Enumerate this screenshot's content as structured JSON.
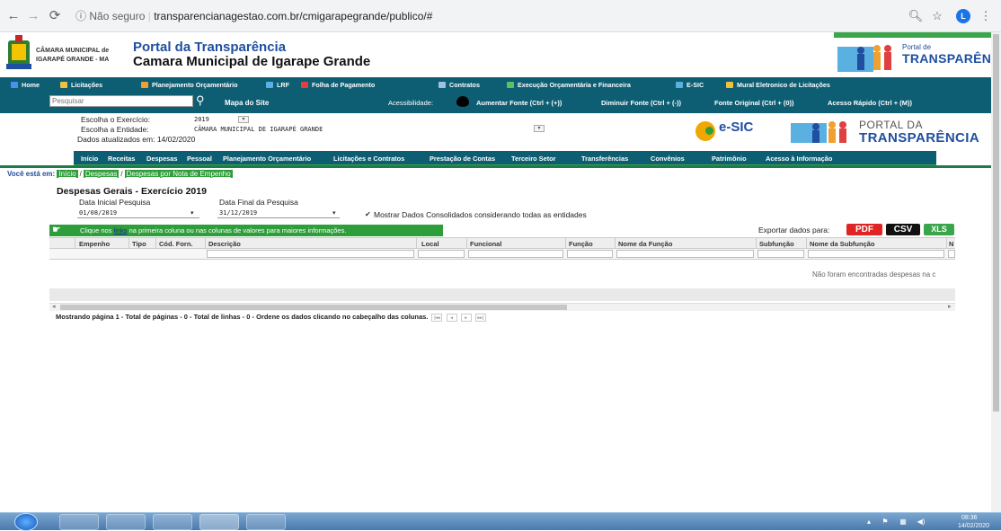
{
  "browser": {
    "security_label": "Não seguro",
    "url": "transparencianagestao.com.br/cmigarapegrande/publico/#",
    "avatar_initial": "L"
  },
  "header": {
    "logo_line1": "CÂMARA MUNICIPAL de",
    "logo_line2": "IGARAPÉ GRANDE - MA",
    "title": "Portal da Transparência",
    "subtitle": "Camara Municipal de Igarape Grande",
    "banner_word1": "Portal de",
    "banner_word2": "TRANSPARÊNCIA"
  },
  "topnav": [
    {
      "label": "Home",
      "icon": "home-icon",
      "color": "#4b8ff0"
    },
    {
      "label": "Licitações",
      "icon": "folder-icon",
      "color": "#f0c040"
    },
    {
      "label": "Planejamento Orçamentário",
      "icon": "pyramid-icon",
      "color": "#f0a030"
    },
    {
      "label": "LRF",
      "icon": "chart-icon",
      "color": "#5ab0e0"
    },
    {
      "label": "Folha de Pagamento",
      "icon": "payroll-icon",
      "color": "#e04040"
    },
    {
      "label": "Contratos",
      "icon": "document-icon",
      "color": "#a0c0e0"
    },
    {
      "label": "Execução Orçamentária e Financeira",
      "icon": "growth-icon",
      "color": "#60c060"
    },
    {
      "label": "E-SIC",
      "icon": "info-icon",
      "color": "#5ab0e0"
    },
    {
      "label": "Mural Eletronico de Licitações",
      "icon": "board-icon",
      "color": "#f0c040"
    }
  ],
  "accessibility": {
    "search_placeholder": "Pesquisar",
    "site_map": "Mapa do Site",
    "label": "Acessibilidade:",
    "increase": "Aumentar Fonte (Ctrl + (+))",
    "decrease": "Diminuir Fonte (Ctrl + (-))",
    "original": "Fonte Original (Ctrl + (0))",
    "quick": "Acesso Rápido (Ctrl + (M))"
  },
  "filter": {
    "exercise_label": "Escolha o Exercício:",
    "exercise_value": "2019",
    "entity_label": "Escolha a Entidade:",
    "entity_value": "CÂMARA MUNICIPAL DE IGARAPÉ GRANDE",
    "updated": "Dados atualizados em: 14/02/2020",
    "esic_logo": "e-SIC",
    "portal_logo_word1": "PORTAL DA",
    "portal_logo_word2": "TRANSPARÊNCIA"
  },
  "mainmenu": [
    "Início",
    "Receitas",
    "Despesas",
    "Pessoal",
    "Planejamento Orçamentário",
    "Licitações e Contratos",
    "Prestação de Contas",
    "Terceiro Setor",
    "Transferências",
    "Convênios",
    "Patrimônio",
    "Acesso à Informação"
  ],
  "breadcrumb": {
    "label": "Você está em:",
    "items": [
      "Início",
      "Despesas",
      "Despesas por Nota de Empenho"
    ]
  },
  "section": {
    "title": "Despesas Gerais - Exercício 2019",
    "start_label": "Data Inicial Pesquisa",
    "start_value": "01/08/2019",
    "end_label": "Data Final da Pesquisa",
    "end_value": "31/12/2019",
    "consolidated_label": "Mostrar Dados Consolidados considerando todas as entidades"
  },
  "infobar": {
    "prefix": "Clique nos ",
    "link": "links",
    "suffix": " na primeira coluna ou nas colunas de valores para maiores informações."
  },
  "export": {
    "label": "Exportar dados para:",
    "pdf": "PDF",
    "csv": "CSV",
    "xls": "XLS"
  },
  "table": {
    "columns": [
      "Empenho",
      "Tipo",
      "Cód. Forn.",
      "Descrição",
      "Local",
      "Funcional",
      "Função",
      "Nome da Função",
      "Subfunção",
      "Nome da Subfunção",
      "N"
    ],
    "empty_message": "Não foram encontradas despesas na c"
  },
  "paging": {
    "text": "Mostrando página 1 - Total de páginas - 0 - Total de linhas - 0 - Ordene os dados clicando no cabeçalho das colunas."
  },
  "taskbar": {
    "time": "08:36",
    "date": "14/02/2020"
  }
}
